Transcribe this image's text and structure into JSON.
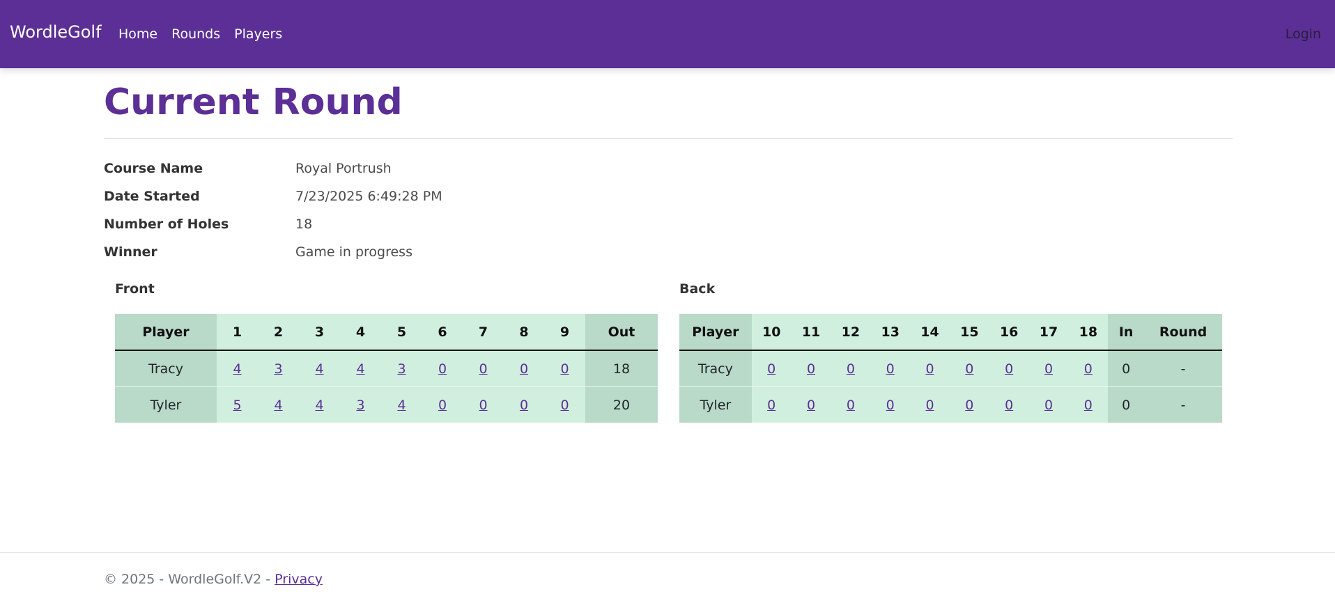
{
  "nav": {
    "brand": "WordleGolf",
    "links": [
      "Home",
      "Rounds",
      "Players"
    ],
    "login": "Login"
  },
  "page": {
    "title": "Current Round"
  },
  "details": [
    {
      "label": "Course Name",
      "value": "Royal Portrush"
    },
    {
      "label": "Date Started",
      "value": "7/23/2025 6:49:28 PM"
    },
    {
      "label": "Number of Holes",
      "value": "18"
    },
    {
      "label": "Winner",
      "value": "Game in progress"
    }
  ],
  "front": {
    "label": "Front",
    "headers": [
      "Player",
      "1",
      "2",
      "3",
      "4",
      "5",
      "6",
      "7",
      "8",
      "9",
      "Out"
    ],
    "rows": [
      {
        "player": "Tracy",
        "scores": [
          "4",
          "3",
          "4",
          "4",
          "3",
          "0",
          "0",
          "0",
          "0"
        ],
        "out": "18"
      },
      {
        "player": "Tyler",
        "scores": [
          "5",
          "4",
          "4",
          "3",
          "4",
          "0",
          "0",
          "0",
          "0"
        ],
        "out": "20"
      }
    ]
  },
  "back": {
    "label": "Back",
    "headers": [
      "Player",
      "10",
      "11",
      "12",
      "13",
      "14",
      "15",
      "16",
      "17",
      "18",
      "In",
      "Round"
    ],
    "rows": [
      {
        "player": "Tracy",
        "scores": [
          "0",
          "0",
          "0",
          "0",
          "0",
          "0",
          "0",
          "0",
          "0"
        ],
        "in": "0",
        "round": "-"
      },
      {
        "player": "Tyler",
        "scores": [
          "0",
          "0",
          "0",
          "0",
          "0",
          "0",
          "0",
          "0",
          "0"
        ],
        "in": "0",
        "round": "-"
      }
    ]
  },
  "footer": {
    "copyright": "© 2025 - WordleGolf.V2 - ",
    "privacy": "Privacy"
  },
  "colors": {
    "brand": "#5b2f95",
    "cell_dark": "#b9d9c9",
    "cell_light": "#d1efdf"
  }
}
